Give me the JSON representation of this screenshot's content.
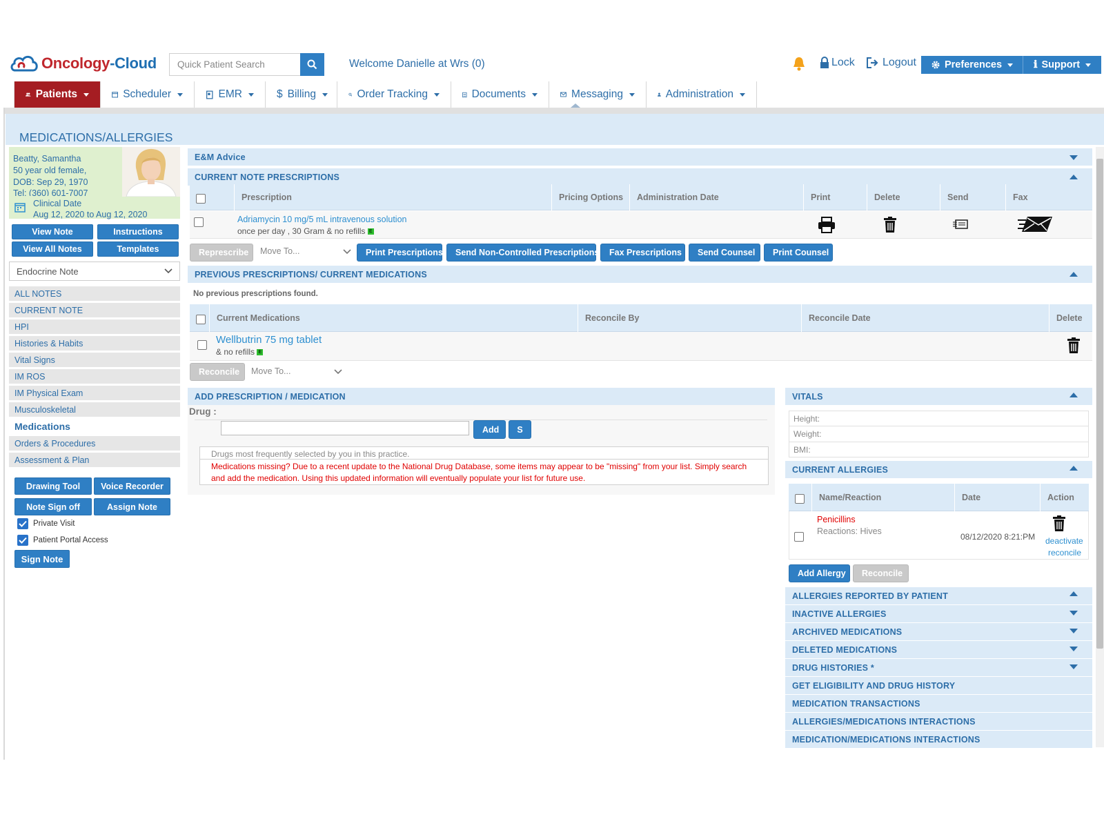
{
  "header": {
    "logo_oncology": "Oncology",
    "logo_cloud": "-Cloud",
    "search_placeholder": "Quick Patient Search",
    "welcome": "Welcome Danielle at Wrs (0)",
    "lock": "Lock",
    "logout": "Logout",
    "preferences": "Preferences",
    "support": "Support"
  },
  "nav": {
    "patients": "Patients",
    "scheduler": "Scheduler",
    "emr": "EMR",
    "billing": "Billing",
    "order_tracking": "Order Tracking",
    "documents": "Documents",
    "messaging": "Messaging",
    "administration": "Administration"
  },
  "page_title": "MEDICATIONS/ALLERGIES",
  "patient": {
    "name": "Beatty, Samantha",
    "age_sex": "50 year old female,",
    "dob": "DOB: Sep 29, 1970",
    "tel": "Tel: (360) 601-7007",
    "clinical_label": "Clinical Date",
    "clinical_range": "Aug 12, 2020 to Aug 12, 2020"
  },
  "left_buttons": {
    "view_note": "View Note",
    "instructions": "Instructions",
    "view_all_notes": "View All Notes",
    "templates": "Templates",
    "drawing_tool": "Drawing Tool",
    "voice_recorder": "Voice Recorder",
    "note_sign_off": "Note Sign off",
    "assign_note": "Assign Note",
    "sign_note": "Sign Note"
  },
  "note_select": "Endocrine Note",
  "menu": [
    "ALL NOTES",
    "CURRENT NOTE",
    "HPI",
    "Histories & Habits",
    "Vital Signs",
    "IM ROS",
    "IM Physical Exam",
    "Musculoskeletal",
    "Medications",
    "Orders & Procedures",
    "Assessment & Plan"
  ],
  "checkboxes": {
    "private_visit": "Private Visit",
    "patient_portal": "Patient Portal Access"
  },
  "em_advice": "E&M Advice",
  "current_rx": {
    "title": "CURRENT NOTE PRESCRIPTIONS",
    "headers": [
      "Prescription",
      "Pricing Options",
      "Administration Date",
      "Print",
      "Delete",
      "Send",
      "Fax"
    ],
    "drug": "Adriamycin 10 mg/5 mL intravenous solution",
    "sig": "once per day , 30 Gram & no refills",
    "e_badge": "E"
  },
  "rx_actions": {
    "represcribe": "Represcribe",
    "move_to": "Move To...",
    "print_prescriptions": "Print Prescriptions",
    "send_noncontrolled": "Send Non-Controlled Prescriptions",
    "fax_prescriptions": "Fax Prescriptions",
    "send_counsel": "Send Counsel",
    "print_counsel": "Print Counsel"
  },
  "previous_rx": {
    "title": "PREVIOUS PRESCRIPTIONS/ CURRENT MEDICATIONS",
    "empty": "No previous prescriptions found.",
    "headers": [
      "Current Medications",
      "Reconcile By",
      "Reconcile Date",
      "Delete"
    ],
    "drug": "Wellbutrin 75 mg tablet",
    "sig": "& no refills",
    "e_badge": "E",
    "reconcile": "Reconcile",
    "move_to": "Move To..."
  },
  "add_rx": {
    "title": "ADD PRESCRIPTION / MEDICATION",
    "drug_label": "Drug :",
    "add": "Add",
    "s": "S",
    "frequent_hint": "Drugs most frequently selected by you in this practice.",
    "warning": "Medications missing? Due to a recent update to the National Drug Database, some items may appear to be \"missing\" from your list. Simply search and add the medication. Using this updated information will eventually populate your list for future use."
  },
  "vitals": {
    "title": "VITALS",
    "height": "Height:",
    "weight": "Weight:",
    "bmi": "BMI:"
  },
  "allergies": {
    "title": "CURRENT ALLERGIES",
    "headers": [
      "Name/Reaction",
      "Date",
      "Action"
    ],
    "name": "Penicillins",
    "reaction": "Reactions: Hives",
    "date": "08/12/2020 8:21:PM",
    "deactivate": "deactivate",
    "reconcile_link": "reconcile",
    "add_allergy": "Add Allergy",
    "reconcile": "Reconcile"
  },
  "right_sections": [
    "ALLERGIES REPORTED BY PATIENT",
    "INACTIVE ALLERGIES",
    "ARCHIVED MEDICATIONS",
    "DELETED MEDICATIONS",
    "DRUG HISTORIES *",
    "GET ELIGIBILITY AND DRUG HISTORY",
    "MEDICATION TRANSACTIONS",
    "ALLERGIES/MEDICATIONS INTERACTIONS",
    "MEDICATION/MEDICATIONS INTERACTIONS"
  ],
  "colors": {
    "brand_red": "#a51d22",
    "brand_blue": "#2f7fc4",
    "section_bg": "#dbeaf7",
    "patient_card": "#dff0cf",
    "warning_red": "#e00000"
  }
}
